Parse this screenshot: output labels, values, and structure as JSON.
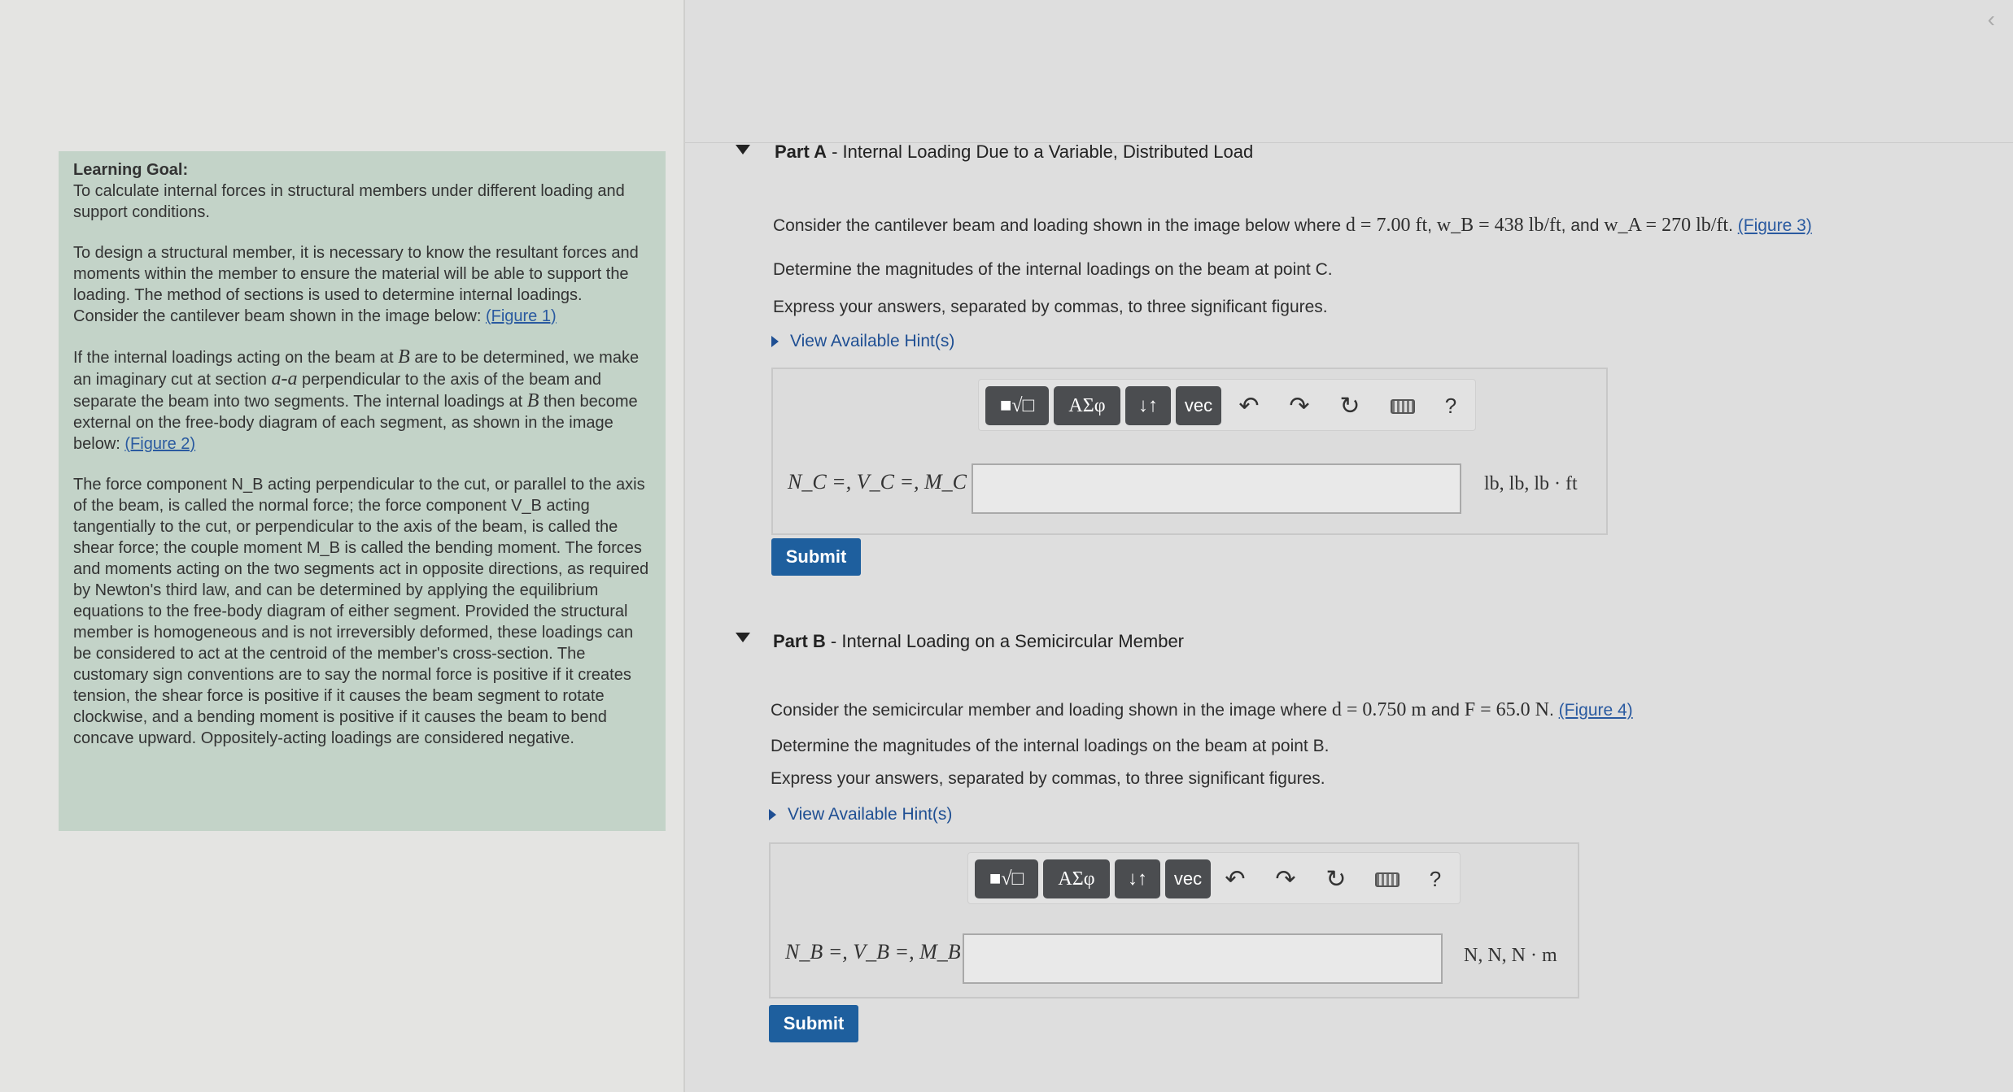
{
  "learning_goal": {
    "title": "Learning Goal:",
    "objective": "To calculate internal forces in structural members under different loading and support conditions.",
    "p1": "To design a structural member, it is necessary to know the resultant forces and moments within the member to ensure the material will be able to support the loading. The method of sections is used to determine internal loadings. Consider the cantilever beam shown in the image below:",
    "p1_link": "(Figure 1)",
    "p2_a": "If the internal loadings acting on the beam at ",
    "p2_b": "B",
    "p2_c": " are to be determined, we make an imaginary cut at section ",
    "p2_d": "a-a",
    "p2_e": " perpendicular to the axis of the beam and separate the beam into two segments. The internal loadings at ",
    "p2_f": "B",
    "p2_g": " then become external on the free-body diagram of each segment, as shown in the image below:",
    "p2_link": "(Figure 2)",
    "p3": "The force component N_B acting perpendicular to the cut, or parallel to the axis of the beam, is called the normal force; the force component V_B acting tangentially to the cut, or perpendicular to the axis of the beam, is called the shear force; the couple moment M_B is called the bending moment. The forces and moments acting on the two segments act in opposite directions, as required by Newton's third law, and can be determined by applying the equilibrium equations to the free-body diagram of either segment. Provided the structural member is homogeneous and is not irreversibly deformed, these loadings can be considered to act at the centroid of the member's cross-section. The customary sign conventions are to say the normal force is positive if it creates tension, the shear force is positive if it causes the beam segment to rotate clockwise, and a bending moment is positive if it causes the beam to bend concave upward. Oppositely-acting loadings are considered negative."
  },
  "part_a": {
    "label": "Part A",
    "title": " - Internal Loading Due to a Variable, Distributed Load",
    "line1_a": "Consider the cantilever beam and loading shown in the image below where ",
    "d": "d = 7.00 ft",
    "wb": "w_B = 438 lb/ft",
    "and": ", and ",
    "wa": "w_A = 270 lb/ft",
    "figure_link": "(Figure 3)",
    "line2": "Determine the magnitudes of the internal loadings on the beam at point C.",
    "line3": "Express your answers, separated by commas, to three significant figures.",
    "hint": "View Available Hint(s)",
    "answer_label": "N_C =, V_C =, M_C =",
    "units": "lb, lb, lb · ft",
    "input_value": "",
    "submit": "Submit"
  },
  "part_b": {
    "label": "Part B",
    "title": " - Internal Loading on a Semicircular Member",
    "line1_a": "Consider the semicircular member and loading shown in the image where ",
    "d": "d = 0.750 m",
    "and": " and ",
    "f": "F = 65.0 N",
    "figure_link": "(Figure 4)",
    "line2": "Determine the magnitudes of the internal loadings on the beam at point B.",
    "line3": "Express your answers, separated by commas, to three significant figures.",
    "hint": "View Available Hint(s)",
    "answer_label": "N_B =, V_B =, M_B =",
    "units": "N, N, N · m",
    "input_value": "",
    "submit": "Submit"
  },
  "toolbar": {
    "templates": "■√□",
    "greek": "ΑΣφ",
    "arrows": "↓↑",
    "vec": "vec",
    "help": "?"
  },
  "colors": {
    "goal_bg": "#c3d3c8",
    "submit_bg": "#1e5f9e",
    "toolbar_btn": "#4b4d50",
    "link": "#2a5aa0"
  }
}
